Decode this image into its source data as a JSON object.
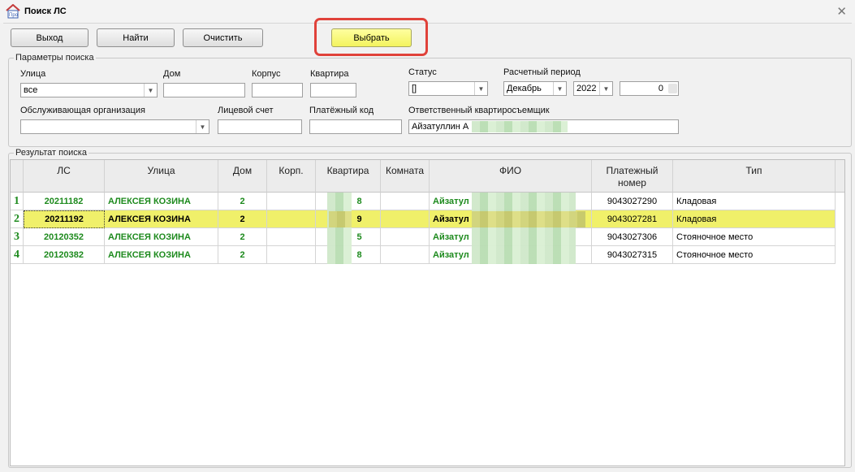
{
  "window": {
    "title": "Поиск ЛС",
    "icon": "app-logo-icon"
  },
  "toolbar": {
    "exit_label": "Выход",
    "find_label": "Найти",
    "clear_label": "Очистить",
    "select_label": "Выбрать"
  },
  "search": {
    "legend": "Параметры поиска",
    "street_label": "Улица",
    "street_value": "все",
    "house_label": "Дом",
    "house_value": "",
    "korpus_label": "Корпус",
    "korpus_value": "",
    "apt_label": "Квартира",
    "apt_value": "",
    "status_label": "Статус",
    "status_value": "[]",
    "period_label": "Расчетный период",
    "month_value": "Декабрь",
    "year_value": "2022",
    "period_number": "0",
    "org_label": "Обслуживающая организация",
    "org_value": "",
    "account_label": "Лицевой счет",
    "account_value": "",
    "paycode_label": "Платёжный код",
    "paycode_value": "",
    "tenant_label": "Ответственный квартиросъемщик",
    "tenant_value": "Айзатуллин А"
  },
  "results": {
    "legend": "Результат поиска",
    "columns": [
      "ЛС",
      "Улица",
      "Дом",
      "Корп.",
      "Квартира",
      "Комната",
      "ФИО",
      "Платежный номер",
      "Тип"
    ],
    "rows": [
      {
        "num": "1",
        "ls": "20211182",
        "street": "АЛЕКСЕЯ КОЗИНА",
        "house": "2",
        "korp": "",
        "apt": "8",
        "room": "",
        "fio": "Айзатул",
        "paynum": "9043027290",
        "type": "Кладовая"
      },
      {
        "num": "2",
        "ls": "20211192",
        "street": "АЛЕКСЕЯ КОЗИНА",
        "house": "2",
        "korp": "",
        "apt": "9",
        "room": "",
        "fio": "Айзатул",
        "paynum": "9043027281",
        "type": "Кладовая"
      },
      {
        "num": "3",
        "ls": "20120352",
        "street": "АЛЕКСЕЯ КОЗИНА",
        "house": "2",
        "korp": "",
        "apt": "5",
        "room": "",
        "fio": "Айзатул",
        "paynum": "9043027306",
        "type": "Стояночное место"
      },
      {
        "num": "4",
        "ls": "20120382",
        "street": "АЛЕКСЕЯ КОЗИНА",
        "house": "2",
        "korp": "",
        "apt": "8",
        "room": "",
        "fio": "Айзатул",
        "paynum": "9043027315",
        "type": "Стояночное место"
      }
    ],
    "selected_row": 2
  },
  "colors": {
    "selected_row": "#f0f06a",
    "value_green": "#1d8a1d",
    "highlight_frame": "#e0423a"
  }
}
